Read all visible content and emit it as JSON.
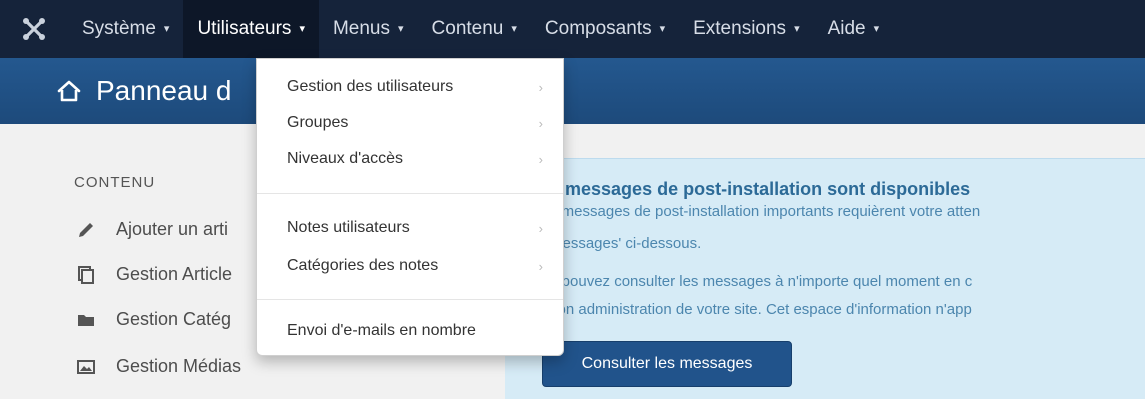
{
  "navbar": {
    "items": [
      {
        "label": "Système"
      },
      {
        "label": "Utilisateurs"
      },
      {
        "label": "Menus"
      },
      {
        "label": "Contenu"
      },
      {
        "label": "Composants"
      },
      {
        "label": "Extensions"
      },
      {
        "label": "Aide"
      }
    ],
    "caret": "▾",
    "background": "#15233a",
    "active_item": "Utilisateurs"
  },
  "subhead": {
    "title": "Panneau d"
  },
  "sidebar": {
    "heading": "CONTENU",
    "items": [
      {
        "label": "Ajouter un arti",
        "icon": "pencil-icon"
      },
      {
        "label": "Gestion Article",
        "icon": "stack-icon"
      },
      {
        "label": "Gestion Catég",
        "icon": "folder-icon"
      },
      {
        "label": "Gestion Médias",
        "icon": "image-icon"
      }
    ]
  },
  "dropdown": {
    "items": [
      {
        "label": "Gestion des utilisateurs",
        "arrow": "›"
      },
      {
        "label": "Groupes",
        "arrow": "›"
      },
      {
        "label": "Niveaux d'accès",
        "arrow": "›"
      },
      {
        "label": "Notes utilisateurs",
        "arrow": "›"
      },
      {
        "label": "Catégories des notes",
        "arrow": "›"
      },
      {
        "label": "Envoi d'e-mails en nombre"
      }
    ]
  },
  "alert": {
    "title": "s messages de post-installation sont disponibles",
    "lines": [
      "s messages de post-installation importants requièrent votre atten",
      "messages' ci-dessous.",
      "s pouvez consulter les messages à n'importe quel moment en c",
      "tion administration de votre site. Cet espace d'information n'app"
    ],
    "button": "Consulter les messages",
    "background": "#d6ebf6",
    "title_color": "#2c6a97"
  }
}
